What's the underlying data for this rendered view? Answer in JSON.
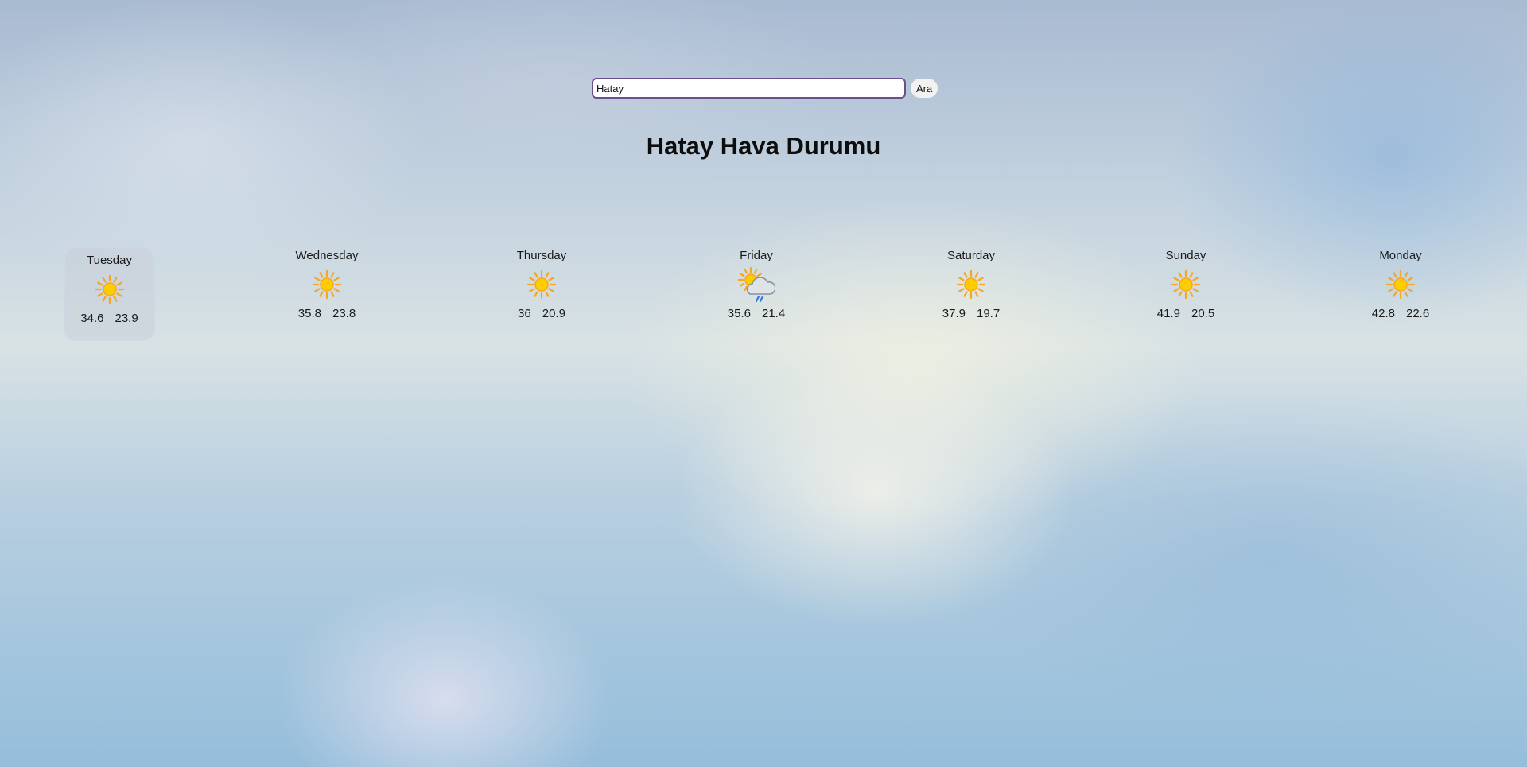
{
  "search": {
    "value": "Hatay",
    "button_label": "Ara"
  },
  "title": "Hatay Hava Durumu",
  "forecast": [
    {
      "day": "Tuesday",
      "icon": "sun-icon",
      "max": "34.6",
      "min": "23.9",
      "selected": true
    },
    {
      "day": "Wednesday",
      "icon": "sun-icon",
      "max": "35.8",
      "min": "23.8",
      "selected": false
    },
    {
      "day": "Thursday",
      "icon": "sun-icon",
      "max": "36",
      "min": "20.9",
      "selected": false
    },
    {
      "day": "Friday",
      "icon": "sun-cloud-rain-icon",
      "max": "35.6",
      "min": "21.4",
      "selected": false
    },
    {
      "day": "Saturday",
      "icon": "sun-icon",
      "max": "37.9",
      "min": "19.7",
      "selected": false
    },
    {
      "day": "Sunday",
      "icon": "sun-icon",
      "max": "41.9",
      "min": "20.5",
      "selected": false
    },
    {
      "day": "Monday",
      "icon": "sun-icon",
      "max": "42.8",
      "min": "22.6",
      "selected": false
    }
  ],
  "colors": {
    "input_border": "#6a4f8e",
    "sun": "#ffcc00",
    "sun_rays": "#f5a623",
    "rain": "#2f7fd8"
  }
}
